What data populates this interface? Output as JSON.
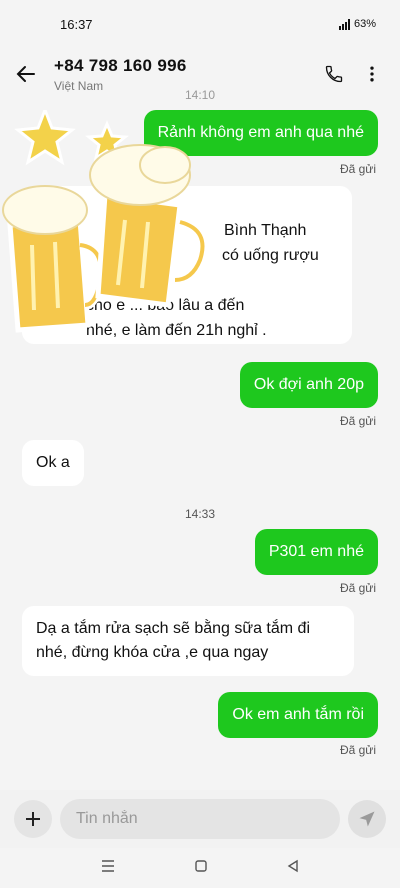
{
  "status_bar": {
    "time": "16:37",
    "battery": "63%"
  },
  "header": {
    "title": "+84 798 160 996",
    "subtitle": "Việt Nam"
  },
  "chat": {
    "time_top": "14:10",
    "messages": [
      {
        "dir": "out",
        "text": "Rảnh không em anh qua nhé",
        "status": "Đã gửi"
      },
      {
        "dir": "in",
        "lines": [
          "Bình Thạnh",
          "có uống rượu",
          "b... ý.",
          "cho e ... bao lâu a đến",
          "nhé, e làm đến 21h nghỉ ."
        ]
      },
      {
        "dir": "out",
        "text": "Ok đợi anh 20p",
        "status": "Đã gửi"
      },
      {
        "dir": "in",
        "text": "Ok a"
      },
      {
        "dir": "out",
        "text": "P301 em nhé",
        "status": "Đã gửi"
      },
      {
        "dir": "in",
        "text": "Dạ a tắm rửa sạch sẽ bằng sữa tắm đi nhé, đừng khóa cửa ,e qua ngay"
      },
      {
        "dir": "out",
        "text": "Ok em anh tắm rồi",
        "status": "Đã gửi"
      }
    ],
    "time_sep": "14:33"
  },
  "input": {
    "placeholder": "Tin nhắn"
  },
  "colors": {
    "outgoing": "#1ec81e",
    "incoming": "#ffffff",
    "background": "#f4f4f4"
  },
  "icons": [
    "back-arrow-icon",
    "phone-icon",
    "more-vert-icon",
    "plus-icon",
    "send-icon",
    "menu-icon",
    "home-icon",
    "back-triangle-icon",
    "beer-mug-icon",
    "star-icon"
  ]
}
